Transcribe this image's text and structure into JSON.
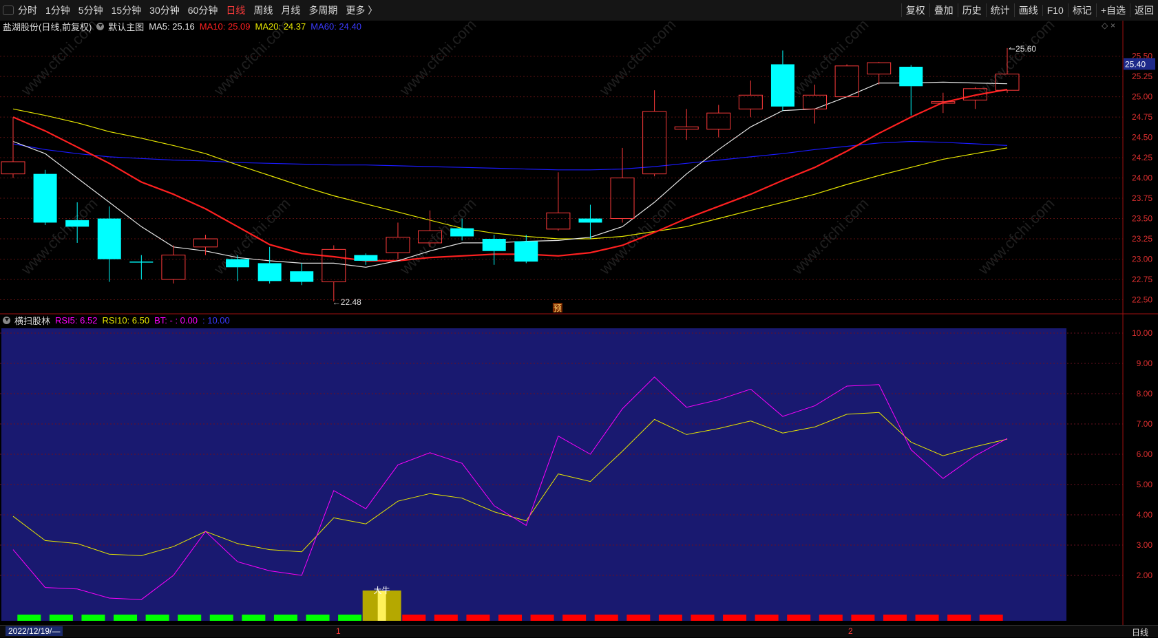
{
  "toolbar": {
    "periods": [
      "分时",
      "1分钟",
      "5分钟",
      "15分钟",
      "30分钟",
      "60分钟",
      "日线",
      "周线",
      "月线",
      "多周期",
      "更多 〉"
    ],
    "active_period": "日线",
    "tools": [
      "复权",
      "叠加",
      "历史",
      "统计",
      "画线",
      "F10",
      "标记",
      "+自选",
      "返回"
    ]
  },
  "main_header": {
    "stock": "盐湖股份(日线,前复权)",
    "template": "默认主图",
    "ma5": "MA5: 25.16",
    "ma10": "MA10: 25.09",
    "ma20": "MA20: 24.37",
    "ma60": "MA60: 24.40"
  },
  "sub_header": {
    "indicator": "横扫股林",
    "rsi5": "RSI5: 6.52",
    "rsi10": "RSI10: 6.50",
    "bt": "BT: - : 0.00",
    "extra": ": 10.00"
  },
  "colors": {
    "up": "#ff3b3b",
    "down": "#00ffff",
    "ma5": "#e6e6e6",
    "ma10": "#ff2020",
    "ma20": "#e6e600",
    "ma60": "#1a1aff",
    "rsi5": "#ff00ff",
    "rsi10": "#e6e600",
    "sub_bg": "#191970",
    "price_tag": "#1e2a8a"
  },
  "markers": {
    "high": "25.60",
    "low": "22.48",
    "yu": "预",
    "daniu": "大牛"
  },
  "bottom": {
    "date_range": "2022/12/19/—",
    "tick1": "1",
    "tick2": "2",
    "period": "日线"
  },
  "chart_data": [
    {
      "type": "candlestick",
      "ylim": [
        22.36,
        25.87
      ],
      "yticks": [
        "25.50",
        "25.25",
        "25.00",
        "24.75",
        "24.50",
        "24.25",
        "24.00",
        "23.75",
        "23.50",
        "23.25",
        "23.00",
        "22.75",
        "22.50"
      ],
      "last_price": "25.40",
      "candles": [
        {
          "o": 24.05,
          "h": 24.75,
          "l": 24.0,
          "c": 24.2
        },
        {
          "o": 24.05,
          "h": 24.1,
          "l": 23.42,
          "c": 23.45
        },
        {
          "o": 23.48,
          "h": 23.7,
          "l": 23.2,
          "c": 23.4
        },
        {
          "o": 23.5,
          "h": 23.65,
          "l": 22.72,
          "c": 23.0
        },
        {
          "o": 22.97,
          "h": 23.05,
          "l": 22.75,
          "c": 22.96
        },
        {
          "o": 22.75,
          "h": 23.17,
          "l": 22.7,
          "c": 23.05
        },
        {
          "o": 23.15,
          "h": 23.3,
          "l": 23.05,
          "c": 23.25
        },
        {
          "o": 23.0,
          "h": 23.05,
          "l": 22.73,
          "c": 22.9
        },
        {
          "o": 22.95,
          "h": 23.15,
          "l": 22.7,
          "c": 22.73
        },
        {
          "o": 22.85,
          "h": 22.95,
          "l": 22.68,
          "c": 22.72
        },
        {
          "o": 22.72,
          "h": 23.17,
          "l": 22.48,
          "c": 23.12
        },
        {
          "o": 23.05,
          "h": 23.07,
          "l": 22.93,
          "c": 22.98
        },
        {
          "o": 23.08,
          "h": 23.45,
          "l": 23.0,
          "c": 23.27
        },
        {
          "o": 23.2,
          "h": 23.6,
          "l": 23.15,
          "c": 23.35
        },
        {
          "o": 23.38,
          "h": 23.5,
          "l": 23.23,
          "c": 23.28
        },
        {
          "o": 23.25,
          "h": 23.3,
          "l": 22.93,
          "c": 23.1
        },
        {
          "o": 23.22,
          "h": 23.3,
          "l": 22.95,
          "c": 22.97
        },
        {
          "o": 23.37,
          "h": 24.07,
          "l": 23.35,
          "c": 23.57
        },
        {
          "o": 23.5,
          "h": 23.67,
          "l": 23.25,
          "c": 23.45
        },
        {
          "o": 23.5,
          "h": 24.37,
          "l": 23.45,
          "c": 24.0
        },
        {
          "o": 24.05,
          "h": 25.08,
          "l": 24.02,
          "c": 24.82
        },
        {
          "o": 24.6,
          "h": 24.85,
          "l": 24.47,
          "c": 24.63
        },
        {
          "o": 24.6,
          "h": 24.9,
          "l": 24.5,
          "c": 24.8
        },
        {
          "o": 24.85,
          "h": 25.2,
          "l": 24.75,
          "c": 25.02
        },
        {
          "o": 25.4,
          "h": 25.57,
          "l": 24.83,
          "c": 24.88
        },
        {
          "o": 24.85,
          "h": 25.15,
          "l": 24.67,
          "c": 25.02
        },
        {
          "o": 25.0,
          "h": 25.4,
          "l": 25.0,
          "c": 25.38
        },
        {
          "o": 25.28,
          "h": 25.43,
          "l": 25.15,
          "c": 25.42
        },
        {
          "o": 25.37,
          "h": 25.39,
          "l": 24.77,
          "c": 25.13
        },
        {
          "o": 24.92,
          "h": 25.05,
          "l": 24.8,
          "c": 24.94
        },
        {
          "o": 24.96,
          "h": 25.12,
          "l": 24.85,
          "c": 25.1
        },
        {
          "o": 25.08,
          "h": 25.6,
          "l": 25.05,
          "c": 25.28
        }
      ],
      "ma5": [
        24.45,
        24.3,
        24.0,
        23.7,
        23.4,
        23.15,
        23.1,
        23.02,
        22.98,
        22.95,
        22.95,
        22.9,
        22.98,
        23.1,
        23.2,
        23.2,
        23.22,
        23.23,
        23.27,
        23.4,
        23.7,
        24.05,
        24.35,
        24.63,
        24.83,
        24.85,
        25.0,
        25.17,
        25.17,
        25.18,
        25.17,
        25.16
      ],
      "ma10": [
        24.75,
        24.58,
        24.38,
        24.18,
        23.95,
        23.8,
        23.62,
        23.4,
        23.18,
        23.07,
        23.03,
        22.98,
        22.98,
        23.02,
        23.04,
        23.06,
        23.06,
        23.04,
        23.08,
        23.17,
        23.33,
        23.5,
        23.65,
        23.8,
        23.97,
        24.13,
        24.33,
        24.55,
        24.75,
        24.93,
        25.02,
        25.09
      ],
      "ma20": [
        24.85,
        24.77,
        24.68,
        24.57,
        24.49,
        24.4,
        24.3,
        24.16,
        24.03,
        23.9,
        23.78,
        23.68,
        23.58,
        23.48,
        23.38,
        23.32,
        23.28,
        23.25,
        23.25,
        23.28,
        23.34,
        23.4,
        23.5,
        23.6,
        23.7,
        23.8,
        23.92,
        24.03,
        24.13,
        24.23,
        24.3,
        24.37
      ],
      "ma60": [
        24.42,
        24.35,
        24.3,
        24.26,
        24.24,
        24.22,
        24.21,
        24.19,
        24.18,
        24.17,
        24.16,
        24.16,
        24.15,
        24.14,
        24.13,
        24.12,
        24.11,
        24.1,
        24.1,
        24.11,
        24.14,
        24.18,
        24.22,
        24.26,
        24.3,
        24.35,
        24.39,
        24.43,
        24.45,
        24.44,
        24.42,
        24.4
      ]
    },
    {
      "type": "line",
      "ylim": [
        0.5,
        10.5
      ],
      "yticks": [
        "10.00",
        "9.00",
        "8.00",
        "7.00",
        "6.00",
        "5.00",
        "4.00",
        "3.00",
        "2.00"
      ],
      "series": [
        {
          "name": "RSI5",
          "values": [
            2.85,
            1.6,
            1.55,
            1.25,
            1.2,
            2.0,
            3.45,
            2.45,
            2.15,
            2.0,
            4.8,
            4.2,
            5.65,
            6.05,
            5.7,
            4.3,
            3.65,
            6.6,
            6.0,
            7.5,
            8.55,
            7.55,
            7.8,
            8.15,
            7.25,
            7.6,
            8.25,
            8.3,
            6.15,
            5.2,
            5.95,
            6.52
          ]
        },
        {
          "name": "RSI10",
          "values": [
            3.95,
            3.15,
            3.05,
            2.7,
            2.65,
            2.95,
            3.45,
            3.05,
            2.85,
            2.78,
            3.9,
            3.7,
            4.45,
            4.7,
            4.55,
            4.1,
            3.8,
            5.35,
            5.1,
            6.1,
            7.15,
            6.65,
            6.85,
            7.1,
            6.7,
            6.9,
            7.32,
            7.38,
            6.4,
            5.95,
            6.25,
            6.5
          ]
        }
      ],
      "bars": [
        "up",
        "up",
        "up",
        "up",
        "up",
        "up",
        "up",
        "up",
        "up",
        "up",
        "up",
        "special",
        "down",
        "down",
        "down",
        "down",
        "down",
        "down",
        "down",
        "down",
        "down",
        "down",
        "down",
        "down",
        "down",
        "down",
        "down",
        "down",
        "down",
        "down",
        "down"
      ]
    }
  ]
}
